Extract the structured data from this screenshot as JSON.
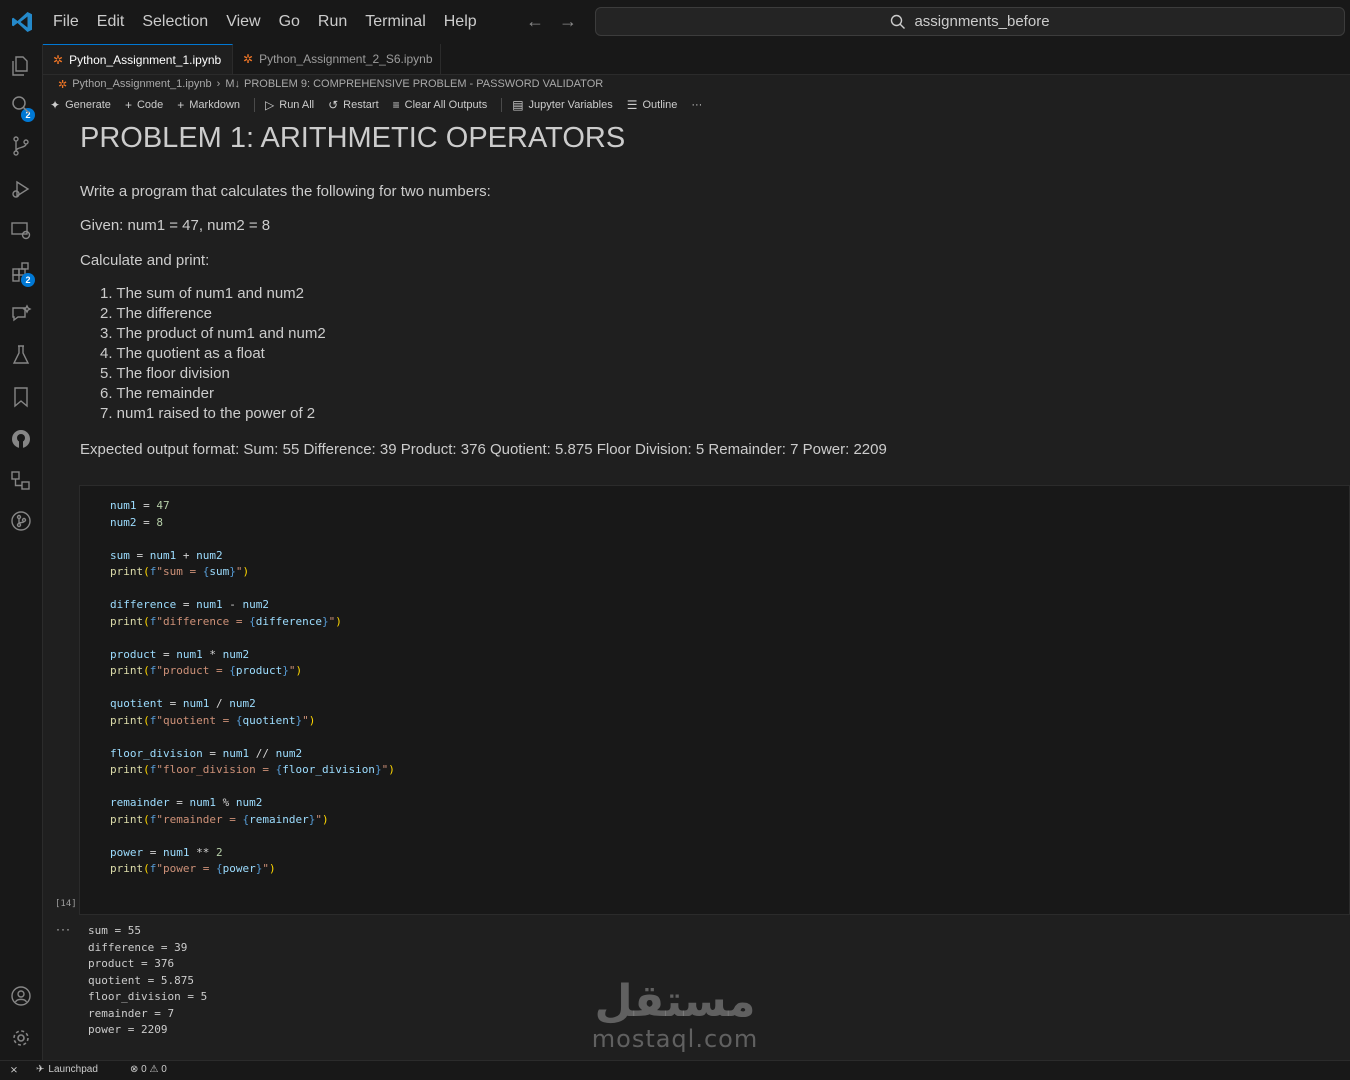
{
  "menu": [
    "File",
    "Edit",
    "Selection",
    "View",
    "Go",
    "Run",
    "Terminal",
    "Help"
  ],
  "search": {
    "text": "assignments_before"
  },
  "activity": {
    "explorer_badge": "2",
    "extensions_badge": "2"
  },
  "tabs": [
    {
      "label": "Python_Assignment_1.ipynb"
    },
    {
      "label": "Python_Assignment_2_S6.ipynb"
    }
  ],
  "breadcrumb": {
    "file": "Python_Assignment_1.ipynb",
    "md_icon": "M↓",
    "section": "PROBLEM 9: COMPREHENSIVE PROBLEM - PASSWORD VALIDATOR"
  },
  "toolbar": {
    "generate": "Generate",
    "code": "Code",
    "markdown": "Markdown",
    "run_all": "Run All",
    "restart": "Restart",
    "clear_outputs": "Clear All Outputs",
    "variables": "Jupyter Variables",
    "outline": "Outline",
    "more": "···"
  },
  "markdown": {
    "title": "PROBLEM 1: ARITHMETIC OPERATORS",
    "intro": "Write a program that calculates the following for two numbers:",
    "given": "Given: num1 = 47, num2 = 8",
    "calc": "Calculate and print:",
    "items": [
      "1. The sum of num1 and num2",
      "2. The difference",
      "3. The product of num1 and num2",
      "4. The quotient as a float",
      "5. The floor division",
      "6. The remainder",
      "7. num1 raised to the power of 2"
    ],
    "expected": "Expected output format: Sum: 55 Difference: 39 Product: 376 Quotient: 5.875 Floor Division: 5 Remainder: 7 Power: 2209"
  },
  "code_lines": [
    "num1 = 47",
    "num2 = 8",
    "",
    "sum = num1 + num2",
    "print(f\"sum = {sum}\")",
    "",
    "difference = num1 - num2",
    "print(f\"difference = {difference}\")",
    "",
    "product = num1 * num2",
    "print(f\"product = {product}\")",
    "",
    "quotient = num1 / num2",
    "print(f\"quotient = {quotient}\")",
    "",
    "floor_division = num1 // num2",
    "print(f\"floor_division = {floor_division}\")",
    "",
    "remainder = num1 % num2",
    "print(f\"remainder = {remainder}\")",
    "",
    "power = num1 ** 2",
    "print(f\"power = {power}\")"
  ],
  "execution_count": "[14]",
  "output_toggle": "···",
  "output_lines": [
    "sum = 55",
    "difference = 39",
    "product = 376",
    "quotient = 5.875",
    "floor_division = 5",
    "remainder = 7",
    "power = 2209"
  ],
  "watermark": {
    "arabic": "مستقل",
    "latin": "mostaql.com"
  },
  "statusbar": {
    "launchpad": "Launchpad",
    "errors": "0",
    "warnings": "0"
  },
  "colors": {
    "accent": "#0078d4",
    "jupyter": "#f37726",
    "background": "#1f1f1f"
  }
}
